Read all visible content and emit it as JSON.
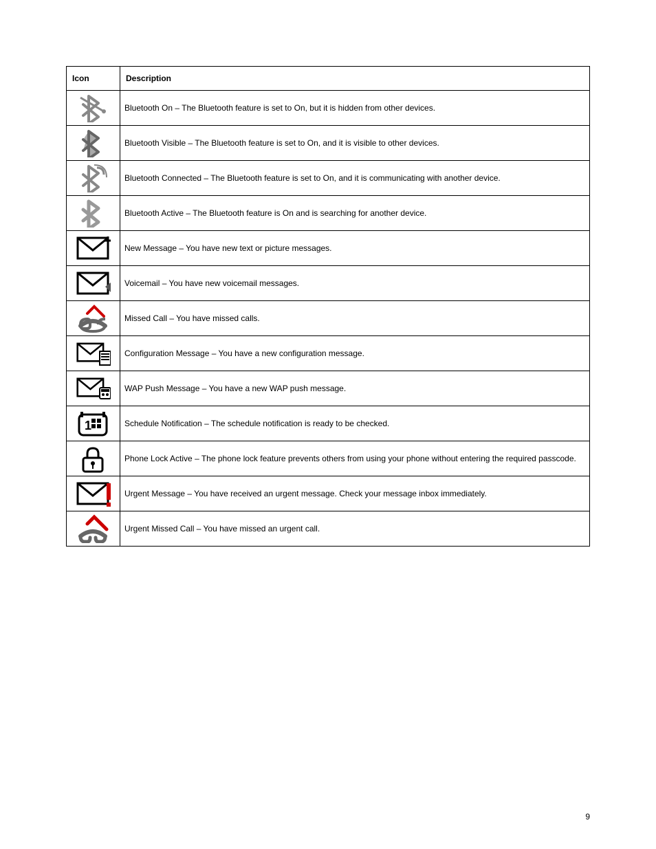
{
  "table": {
    "headers": {
      "icon": "Icon",
      "description": "Description"
    },
    "rows": [
      {
        "icon_name": "bluetooth-hidden-icon",
        "svg": "bt_hidden",
        "description": "Bluetooth On – The Bluetooth feature is set to On, but it is hidden from other devices."
      },
      {
        "icon_name": "bluetooth-visible-icon",
        "svg": "bt_visible",
        "description": "Bluetooth Visible – The Bluetooth feature is set to On, and it is visible to other devices."
      },
      {
        "icon_name": "bluetooth-connected-icon",
        "svg": "bt_connected",
        "description": "Bluetooth Connected – The Bluetooth feature is set to On, and it is communicating with another device."
      },
      {
        "icon_name": "bluetooth-searching-icon",
        "svg": "bt_search",
        "description": "Bluetooth Active – The Bluetooth feature is On and is searching for another device."
      },
      {
        "icon_name": "new-message-icon",
        "svg": "msg_new",
        "description": "New Message – You have new text or picture messages."
      },
      {
        "icon_name": "voicemail-icon",
        "svg": "msg_voice",
        "description": "Voicemail – You have new voicemail messages."
      },
      {
        "icon_name": "missed-call-icon",
        "svg": "missed_call",
        "description": "Missed Call – You have missed calls."
      },
      {
        "icon_name": "config-message-icon",
        "svg": "msg_config",
        "description": "Configuration Message – You have a new configuration message."
      },
      {
        "icon_name": "push-message-icon",
        "svg": "msg_push",
        "description": "WAP Push Message – You have a new WAP push message."
      },
      {
        "icon_name": "schedule-icon",
        "svg": "schedule",
        "description": "Schedule Notification – The schedule notification is ready to be checked."
      },
      {
        "icon_name": "phone-lock-icon",
        "svg": "lock",
        "description": "Phone Lock Active – The phone lock feature prevents others from using your phone without entering the required passcode."
      },
      {
        "icon_name": "urgent-message-icon",
        "svg": "msg_urgent",
        "description": "Urgent Message – You have received an urgent message. Check your message inbox immediately."
      },
      {
        "icon_name": "urgent-missed-call-icon",
        "svg": "missed_urgent",
        "description": "Urgent Missed Call – You have missed an urgent call."
      }
    ]
  },
  "page_number": "9"
}
